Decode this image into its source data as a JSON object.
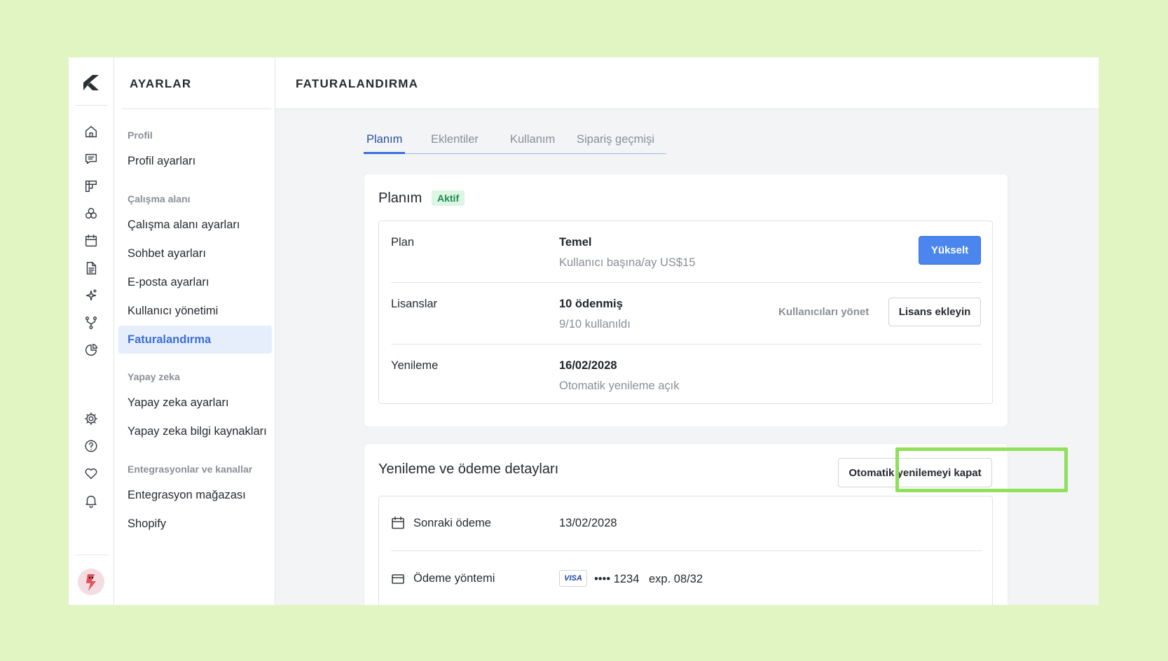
{
  "rail": {
    "icons": [
      "home-icon",
      "chat-icon",
      "board-icon",
      "circles-icon",
      "calendar-icon",
      "document-icon",
      "sparkles-icon",
      "branch-icon",
      "pie-chart-icon",
      "gear-icon",
      "help-icon",
      "heart-icon",
      "bell-icon"
    ]
  },
  "settings_panel": {
    "title": "AYARLAR",
    "sections": {
      "profile": "Profil",
      "workspace": "Çalışma alanı",
      "ai": "Yapay zeka",
      "integrations": "Entegrasyonlar ve kanallar"
    },
    "items": {
      "profile_settings": "Profil ayarları",
      "workspace_settings": "Çalışma alanı ayarları",
      "chat_settings": "Sohbet ayarları",
      "email_settings": "E-posta ayarları",
      "user_management": "Kullanıcı yönetimi",
      "billing": "Faturalandırma",
      "ai_settings": "Yapay zeka ayarları",
      "ai_sources": "Yapay zeka bilgi kaynakları",
      "integration_store": "Entegrasyon mağazası",
      "shopify": "Shopify"
    }
  },
  "header": {
    "title": "FATURALANDIRMA"
  },
  "tabs": {
    "plan": "Planım",
    "addons": "Eklentiler",
    "usage": "Kullanım",
    "orders": "Sipariş geçmişi"
  },
  "plan_card": {
    "title": "Planım",
    "badge": "Aktif",
    "plan_label": "Plan",
    "plan_value": "Temel",
    "plan_price": "Kullanıcı başına/ay US$15",
    "upgrade_button": "Yükselt",
    "licenses_label": "Lisanslar",
    "licenses_value": "10 ödenmiş",
    "licenses_used": "9/10 kullanıldı",
    "manage_users_link": "Kullanıcıları yönet",
    "add_license_button": "Lisans ekleyin",
    "renewal_label": "Yenileme",
    "renewal_value": "16/02/2028",
    "renewal_sub": "Otomatik yenileme açık"
  },
  "payment_card": {
    "title": "Yenileme ve ödeme detayları",
    "disable_autorenew_button": "Otomatik yenilemeyi kapat",
    "next_payment_label": "Sonraki ödeme",
    "next_payment_value": "13/02/2028",
    "payment_method_label": "Ödeme yöntemi",
    "card_brand": "VISA",
    "card_mask": "•••• 1234",
    "card_exp": "exp. 08/32"
  },
  "colors": {
    "background": "#e0f5c2",
    "accent": "#4a86ee",
    "highlight": "#8fe05a",
    "badge_bg": "#dcf5e4",
    "badge_text": "#1f8a4c"
  }
}
